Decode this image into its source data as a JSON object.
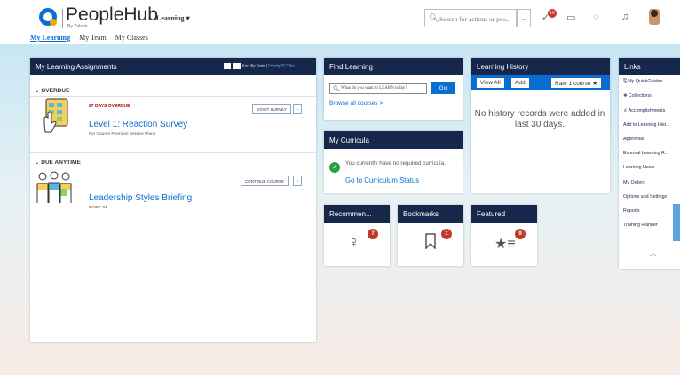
{
  "header": {
    "app_name": "PeopleHub",
    "app_sub": "By Zalaris",
    "module": "Learning",
    "module_caret": "▾",
    "nav_tabs": [
      "My Learning",
      "My Team",
      "My Classes"
    ],
    "search_placeholder": "Search for actions or peo...",
    "notification_count": "10"
  },
  "assignments": {
    "title": "My Learning Assignments",
    "sort_by": "Sort By Date",
    "sort_priority": "Priority",
    "filter": "Filter",
    "overdue_section": "OVERDUE",
    "anytime_section": "DUE ANYTIME",
    "items": [
      {
        "status": "27 DAYS OVERDUE",
        "title": "Level 1: Reaction Survey",
        "subtitle": "For Course Premium Service Plans",
        "action": "START SURVEY"
      },
      {
        "status": "",
        "title": "Leadership Styles Briefing",
        "subtitle": "BRIEF 01",
        "action": "CONTINUE COURSE"
      }
    ]
  },
  "find_learning": {
    "title": "Find Learning",
    "input_placeholder": "What do you want to LEARN today?",
    "go_label": "Go",
    "browse_label": "Browse all courses >"
  },
  "curricula": {
    "title": "My Curricula",
    "message": "You currently have no required curricula.",
    "link": "Go to Curriculum Status"
  },
  "history": {
    "title": "Learning History",
    "view_all": "View All",
    "add": "Add",
    "rate": "Rate 1 course ★",
    "empty_message": "No history records were added in last 30 days."
  },
  "small_tiles": [
    {
      "title": "Recommen...",
      "icon": "lightbulb-icon",
      "count": "7"
    },
    {
      "title": "Bookmarks",
      "icon": "bookmark-icon",
      "count": "1"
    },
    {
      "title": "Featured",
      "icon": "star-list-icon",
      "count": "9"
    }
  ],
  "links": {
    "title": "Links",
    "items": [
      "My QuickGuides",
      "Collections",
      "Accomplishments",
      "Add to Learning Hist...",
      "Approvals",
      "External Learning R...",
      "Learning News",
      "My Orders",
      "Options and Settings",
      "Reports",
      "Training Planner"
    ]
  },
  "colors": {
    "shell_header": "#15284b",
    "accent": "#0a6ed1",
    "overdue": "#bb0000",
    "badge": "#c0392b"
  }
}
